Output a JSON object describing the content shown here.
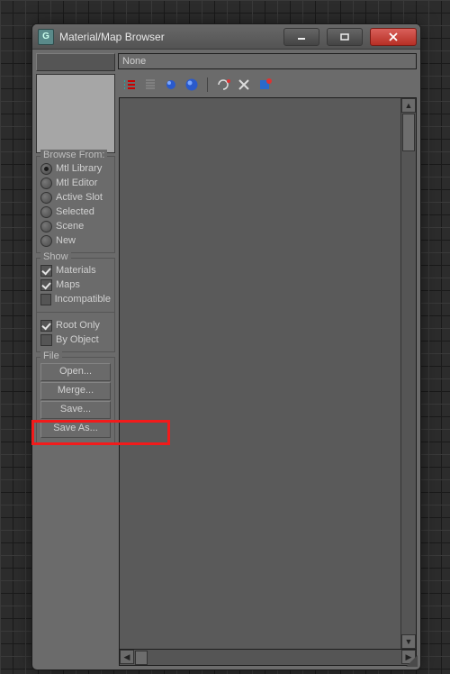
{
  "window": {
    "title": "Material/Map Browser"
  },
  "search": {
    "value": "",
    "placeholder": ""
  },
  "name_display": "None",
  "browse_from": {
    "title": "Browse From:",
    "items": [
      {
        "label": "Mtl Library",
        "selected": true
      },
      {
        "label": "Mtl Editor",
        "selected": false
      },
      {
        "label": "Active Slot",
        "selected": false
      },
      {
        "label": "Selected",
        "selected": false
      },
      {
        "label": "Scene",
        "selected": false
      },
      {
        "label": "New",
        "selected": false
      }
    ]
  },
  "show": {
    "title": "Show",
    "items": [
      {
        "label": "Materials",
        "checked": true
      },
      {
        "label": "Maps",
        "checked": true
      },
      {
        "label": "Incompatible",
        "checked": false
      }
    ],
    "items2": [
      {
        "label": "Root Only",
        "checked": true
      },
      {
        "label": "By Object",
        "checked": false
      }
    ]
  },
  "file": {
    "title": "File",
    "buttons": [
      {
        "label": "Open..."
      },
      {
        "label": "Merge..."
      },
      {
        "label": "Save..."
      },
      {
        "label": "Save As..."
      }
    ]
  },
  "highlight_target": "Merge..."
}
